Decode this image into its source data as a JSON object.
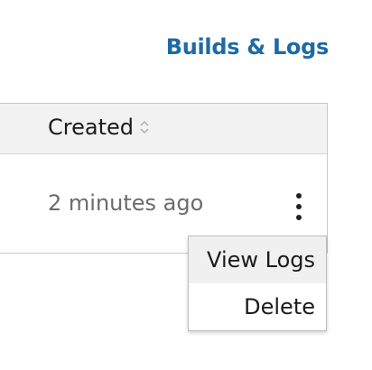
{
  "header": {
    "builds_logs_link": "Builds & Logs"
  },
  "table": {
    "columns": [
      {
        "label": "Created",
        "sortable": true
      }
    ],
    "rows": [
      {
        "created": "2 minutes ago"
      }
    ]
  },
  "menu": {
    "items": [
      {
        "label": "View Logs",
        "highlighted": true
      },
      {
        "label": "Delete",
        "highlighted": false
      }
    ]
  },
  "icons": {
    "sort": "sort-icon",
    "row_actions": "kebab-menu-icon"
  },
  "colors": {
    "link": "#1f6aa3",
    "header_bg": "#f2f2f2",
    "muted_text": "#6b6b6b"
  }
}
